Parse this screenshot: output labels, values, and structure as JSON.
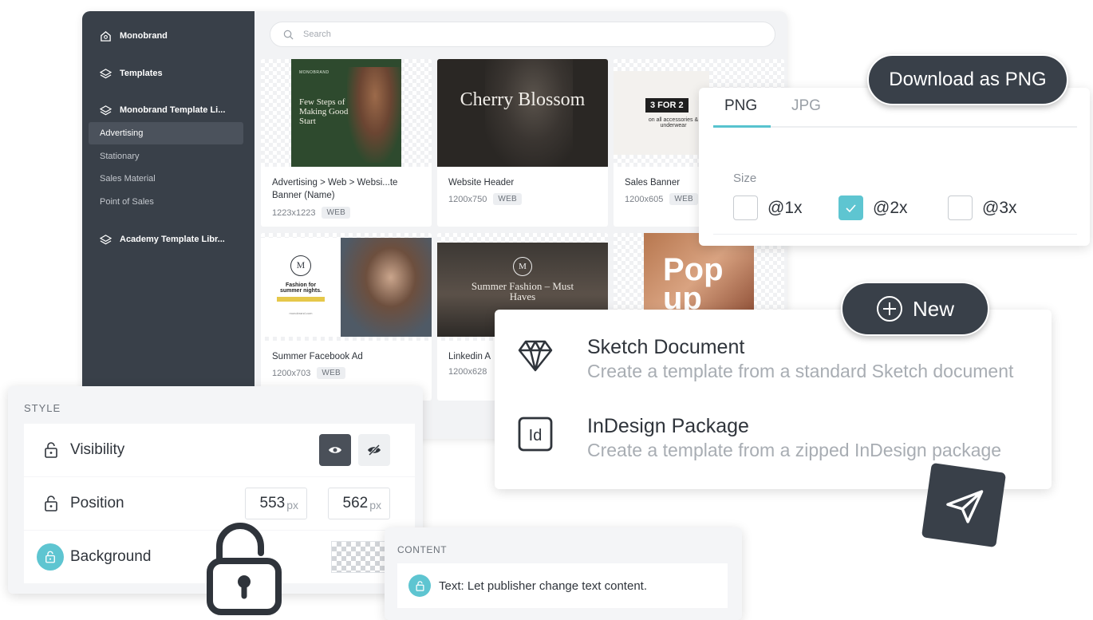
{
  "sidebar": {
    "brand": "Monobrand",
    "templates": "Templates",
    "library": "Monobrand Template Li...",
    "sub_items": [
      "Advertising",
      "Stationary",
      "Sales Material",
      "Point of Sales"
    ],
    "academy": "Academy Template Libr..."
  },
  "search": {
    "placeholder": "Search"
  },
  "cards": [
    {
      "title": "Advertising > Web > Websi...te Banner (Name)",
      "size": "1223x1223",
      "tag": "WEB",
      "thumb_text": "Few Steps of Making Good Start",
      "thumb_brand": "MONOBRAND"
    },
    {
      "title": "Website Header",
      "size": "1200x750",
      "tag": "WEB",
      "thumb_text": "Cherry Blossom"
    },
    {
      "title": "Sales Banner",
      "size": "1200x605",
      "tag": "WEB",
      "thumb_badge": "3 FOR 2",
      "thumb_sub": "on all accessories & underwear"
    },
    {
      "title": "Summer Facebook Ad",
      "size": "1200x703",
      "tag": "WEB",
      "thumb_text": "Fashion for summer nights.",
      "thumb_brand": "monobrand.com"
    },
    {
      "title": "Linkedin A",
      "size": "1200x628",
      "tag": "",
      "thumb_text": "Summer Fashion – Must Haves"
    },
    {
      "title": "",
      "size": "",
      "tag": "",
      "thumb_text": "Pop up"
    }
  ],
  "download": {
    "button": "Download as PNG",
    "tabs": [
      "PNG",
      "JPG"
    ],
    "size_label": "Size",
    "options": [
      {
        "label": "@1x",
        "checked": false
      },
      {
        "label": "@2x",
        "checked": true
      },
      {
        "label": "@3x",
        "checked": false
      }
    ]
  },
  "new_menu": {
    "button": "New",
    "items": [
      {
        "title": "Sketch Document",
        "desc": "Create a template from a standard Sketch document",
        "icon": "diamond-icon"
      },
      {
        "title": "InDesign Package",
        "desc": "Create a template from a zipped InDesign package",
        "icon": "indesign-icon"
      }
    ]
  },
  "style_panel": {
    "heading": "STYLE",
    "rows": [
      {
        "label": "Visibility"
      },
      {
        "label": "Position",
        "x": "553",
        "y": "562",
        "unit": "px"
      },
      {
        "label": "Background"
      }
    ]
  },
  "content_panel": {
    "heading": "CONTENT",
    "text": "Text: Let publisher change text content."
  },
  "colors": {
    "accent": "#5ec5d1",
    "dark": "#394049",
    "sidebar": "#394049"
  }
}
